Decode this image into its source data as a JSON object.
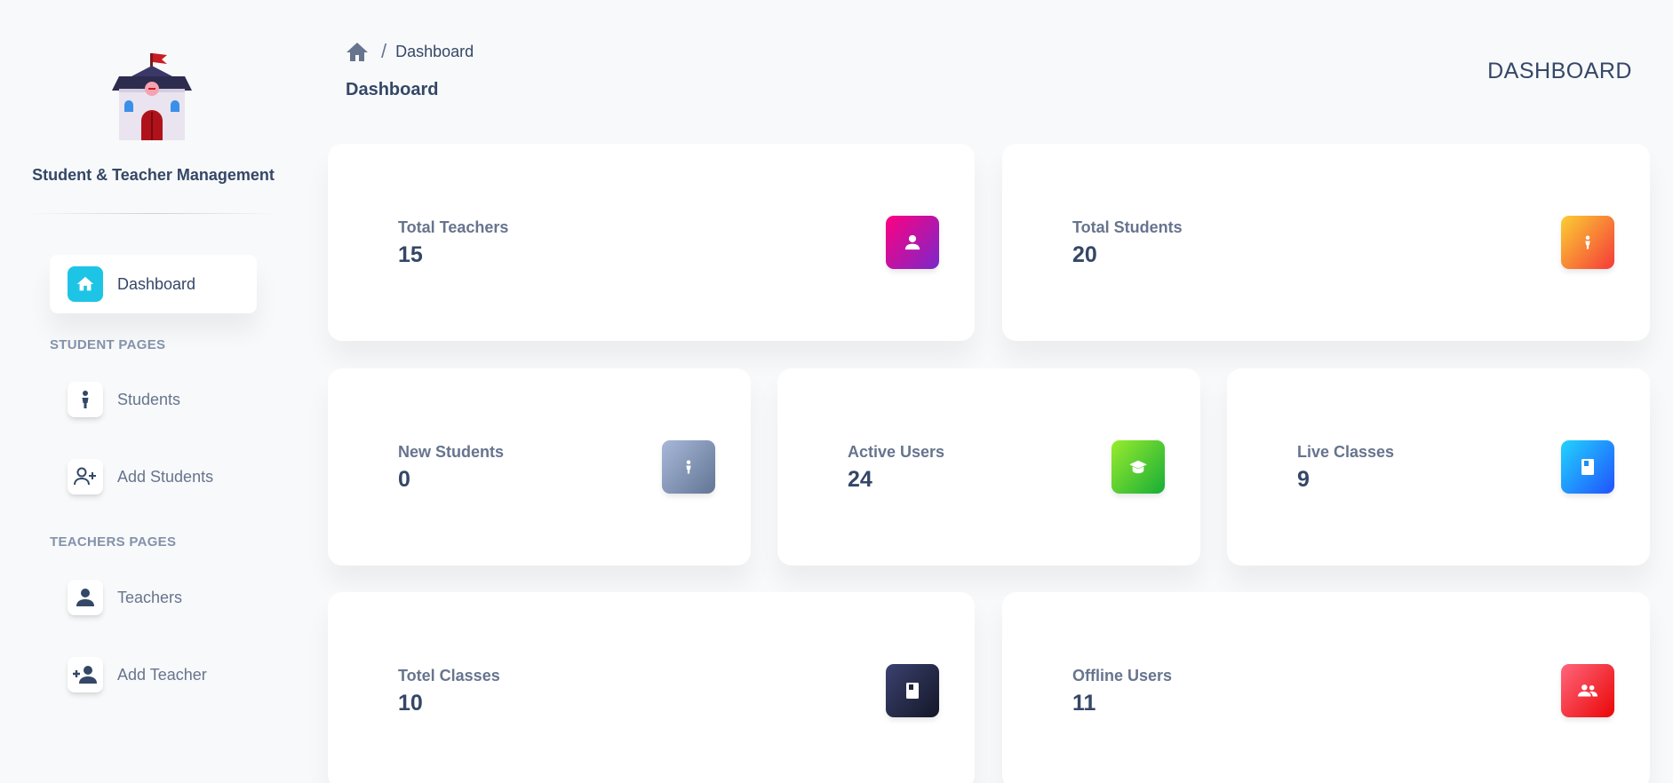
{
  "sidebar": {
    "brand": "Student & Teacher Management",
    "nav": {
      "dashboard": "Dashboard",
      "students": "Students",
      "add_students": "Add Students",
      "teachers": "Teachers",
      "add_teacher": "Add Teacher"
    },
    "sections": {
      "student_pages": "STUDENT PAGES",
      "teachers_pages": "TEACHERS PAGES"
    }
  },
  "header": {
    "breadcrumb_current": "Dashboard",
    "title": "Dashboard",
    "right_title": "DASHBOARD"
  },
  "cards": {
    "total_teachers": {
      "label": "Total Teachers",
      "value": "15",
      "icon": "person-icon",
      "color": "#d41bb1"
    },
    "total_students": {
      "label": "Total Students",
      "value": "20",
      "icon": "student-icon",
      "color": "#f7792a"
    },
    "new_students": {
      "label": "New Students",
      "value": "0",
      "icon": "student-icon",
      "color": "#8d9bb8"
    },
    "active_users": {
      "label": "Active Users",
      "value": "24",
      "icon": "graduation-cap-icon",
      "color": "#3fc523"
    },
    "live_classes": {
      "label": "Live Classes",
      "value": "9",
      "icon": "book-icon",
      "color": "#1b8df7"
    },
    "total_classes": {
      "label": "Totel Classes",
      "value": "10",
      "icon": "book-icon",
      "color": "#22223d"
    },
    "offline_users": {
      "label": "Offline Users",
      "value": "11",
      "icon": "users-icon",
      "color": "#ee2d3a"
    }
  },
  "colors": {
    "text_primary": "#344767",
    "text_secondary": "#67748e",
    "active_nav_icon": "#1ec4e6",
    "background": "#f8f9fa"
  }
}
